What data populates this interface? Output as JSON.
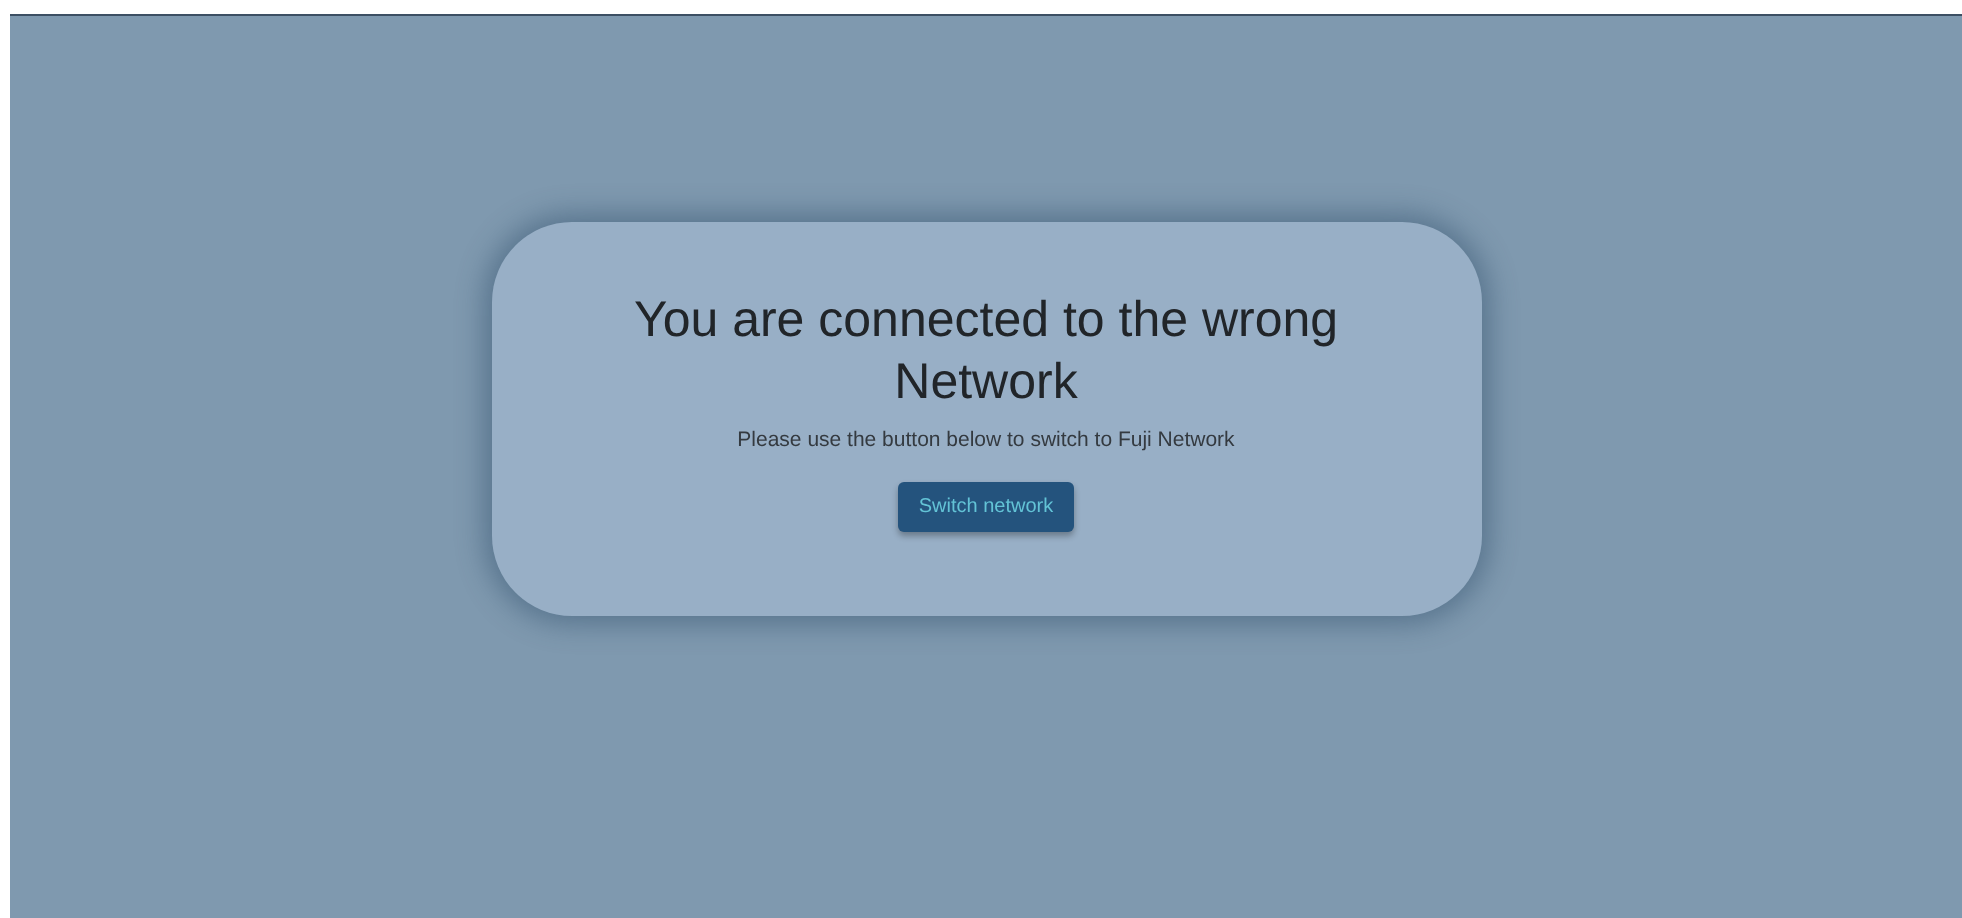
{
  "dialog": {
    "title": "You are connected to the wrong Network",
    "message": "Please use the button below to switch to Fuji Network",
    "button": "Switch network"
  }
}
